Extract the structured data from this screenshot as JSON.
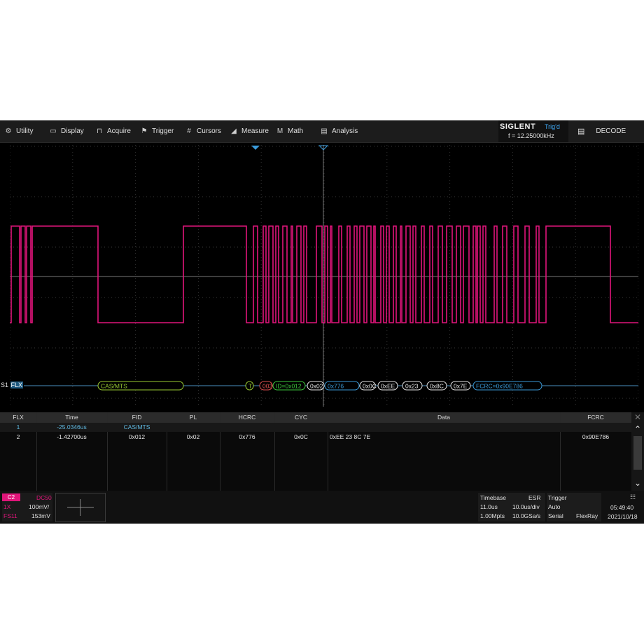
{
  "menu": {
    "utility": "Utility",
    "display": "Display",
    "acquire": "Acquire",
    "trigger": "Trigger",
    "cursors": "Cursors",
    "measure": "Measure",
    "math": "Math",
    "analysis": "Analysis"
  },
  "brand": {
    "name": "SIGLENT",
    "status": "Trig'd",
    "frequency": "f = 12.25000kHz"
  },
  "decode_button": "DECODE",
  "bus": {
    "label": "S1",
    "protocol": "FLX",
    "frame1": "CAS/MTS",
    "tss": "T",
    "num": "003",
    "id": "ID=0x012",
    "pl": "0x02",
    "hcrc": "0x776",
    "cyc": "0x0C",
    "d1": "0xEE",
    "d2": "0x23",
    "d3": "0x8C",
    "d4": "0x7E",
    "fcrc": "FCRC=0x90E786"
  },
  "table": {
    "headers": [
      "FLX",
      "Time",
      "FID",
      "PL",
      "HCRC",
      "CYC",
      "Data",
      "FCRC"
    ],
    "rows": [
      [
        "1",
        "-25.0346us",
        "CAS/MTS",
        "",
        "",
        "",
        "",
        ""
      ],
      [
        "2",
        "-1.42700us",
        "0x012",
        "0x02",
        "0x776",
        "0x0C",
        "0xEE 23 8C 7E",
        "0x90E786"
      ]
    ]
  },
  "channel": {
    "name": "C2",
    "coupling": "DC50",
    "probe": "1X",
    "scale": "100mV/",
    "offset_label": "FS11",
    "offset": "153mV"
  },
  "timebase": {
    "label": "Timebase",
    "mode": "ESR",
    "delay": "11.0us",
    "scale": "10.0us/div",
    "memory": "1.00Mpts",
    "rate": "10.0GSa/s"
  },
  "trigger": {
    "label": "Trigger",
    "mode": "Auto",
    "type": "Serial",
    "source": "FlexRay"
  },
  "clock": {
    "time": "05:49:40",
    "date": "2021/10/18"
  },
  "colors": {
    "trace": "#e0157a",
    "bus_line": "#4a8fc0",
    "frame_green": "#9acd32",
    "id_green": "#3cc83c",
    "data_white": "#e6e6e6",
    "crc_blue": "#3a9ad9",
    "num_red": "#e05050",
    "grid": "#3a3a3a"
  }
}
